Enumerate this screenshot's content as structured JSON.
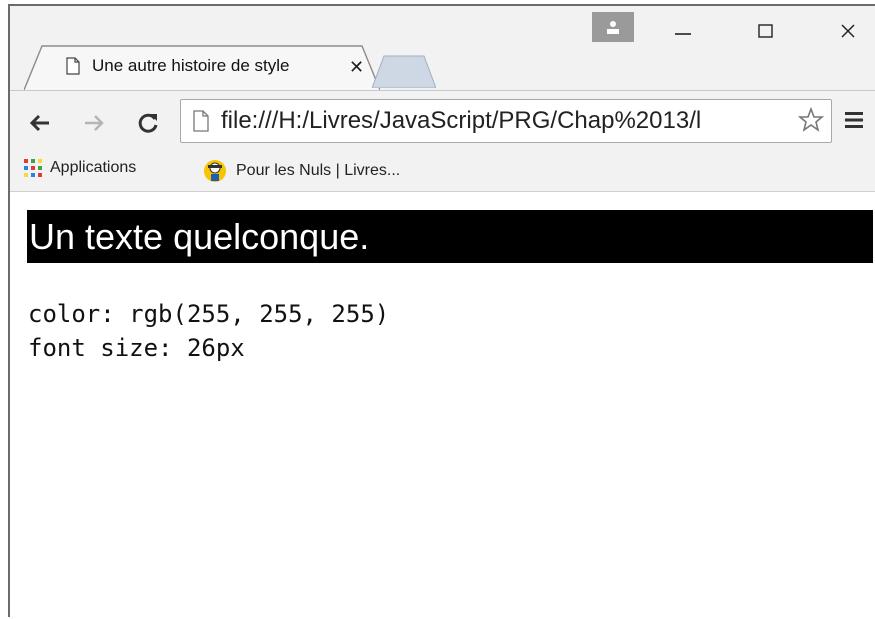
{
  "tab": {
    "title": "Une autre histoire de style",
    "close": "✕"
  },
  "window_controls": {
    "minimize": "—",
    "maximize": "☐",
    "close": "✕"
  },
  "address_bar": {
    "url": "file:///H:/Livres/JavaScript/PRG/Chap%2013/l"
  },
  "bookmarks": [
    {
      "label": "Applications",
      "icon": "apps-grid-icon"
    },
    {
      "label": "Pour les Nuls | Livres...",
      "icon": "dummies-logo-icon"
    }
  ],
  "page": {
    "styled_text": "Un texte quelconque.",
    "output_lines": [
      "color: rgb(255, 255, 255)",
      "font size: 26px"
    ]
  },
  "colors": {
    "styled_bg": "#000000",
    "styled_fg": "#ffffff",
    "chrome_bg": "#f2f2f2"
  }
}
